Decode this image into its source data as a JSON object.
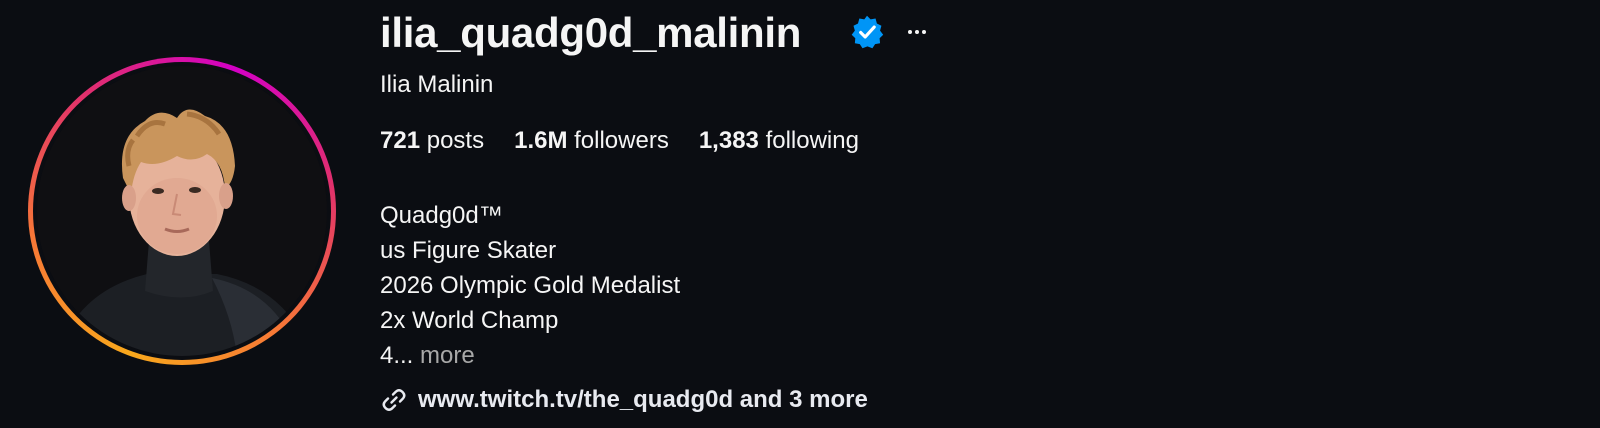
{
  "profile": {
    "username": "ilia_quadg0d_malinin",
    "full_name": "Ilia Malinin",
    "verified_icon": "verified-badge-icon",
    "more_icon": "more-options-icon",
    "avatar_alt": "profile-photo"
  },
  "stats": {
    "posts_count": "721",
    "posts_label": "posts",
    "followers_count": "1.6M",
    "followers_label": "followers",
    "following_count": "1,383",
    "following_label": "following"
  },
  "bio": {
    "lines": [
      "Quadg0d™",
      "us Figure Skater",
      "2026 Olympic Gold Medalist",
      "2x World Champ"
    ],
    "truncated": "4...",
    "more_label": "more"
  },
  "link": {
    "icon": "link-icon",
    "text": "www.twitch.tv/the_quadg0d and 3 more"
  },
  "colors": {
    "background": "#0b0d12",
    "text": "#f5f5f5",
    "muted": "#a8a8a8",
    "verified_blue": "#0095f6",
    "story_ring_start": "#f9a81c",
    "story_ring_end": "#d300c5"
  }
}
